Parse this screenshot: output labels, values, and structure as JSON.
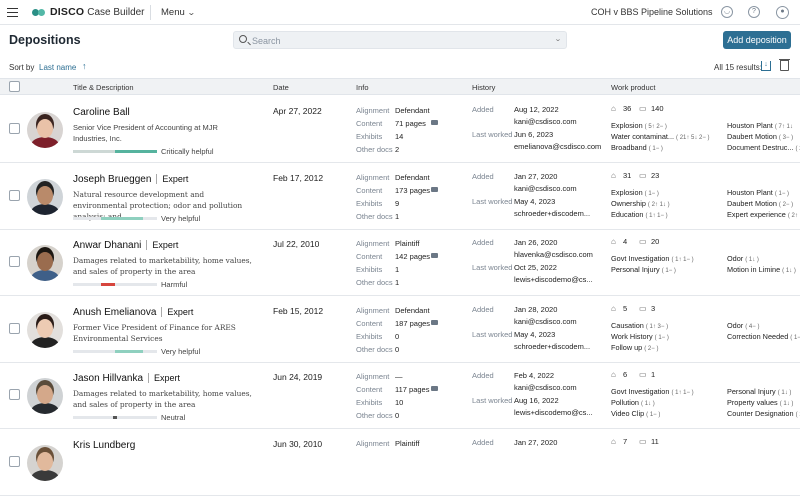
{
  "app": {
    "brand": "DISCO",
    "product": "Case Builder",
    "menu_label": "Menu",
    "project": "COH v BBS Pipeline Solutions"
  },
  "page": {
    "title": "Depositions",
    "search_placeholder": "Search",
    "add_button": "Add deposition"
  },
  "sortbar": {
    "sort_label": "Sort by",
    "sort_value": "Last name",
    "results": "All 15 results:"
  },
  "columns": {
    "title": "Title & Description",
    "date": "Date",
    "info": "Info",
    "history": "History",
    "work": "Work product"
  },
  "colors": {
    "accent": "#2d6f93",
    "helpful": "#56b39e",
    "harmful": "#d6453d",
    "up": "#2a9d6e"
  },
  "rows": [
    {
      "name": "Caroline Ball",
      "expert": "",
      "desc": "Senior Vice President of Accounting at MJR Industries, Inc.",
      "rating": "Critically helpful",
      "date": "Apr 27, 2022",
      "alignment": "Defendant",
      "content": "71 pages",
      "exhibits": "14",
      "other_docs": "2",
      "added_date": "Aug 12, 2022",
      "added_by": "kani@csdisco.com",
      "last_date": "Jun 6, 2023",
      "last_by": "emelianova@csdisco.com",
      "tags": "36",
      "comments": "140",
      "wp_left": [
        {
          "label": "Explosion",
          "pill": "( 5↑ 2− )"
        },
        {
          "label": "Water contaminat...",
          "pill": "( 21↑ 5↓ 2− )"
        },
        {
          "label": "Broadband",
          "pill": "( 1− )"
        }
      ],
      "wp_right": [
        {
          "label": "Houston Plant",
          "pill": "( 7↑ 1↓"
        },
        {
          "label": "Daubert Motion",
          "pill": "( 3− )"
        },
        {
          "label": "Document Destruc...",
          "pill": "( 2− )"
        }
      ]
    },
    {
      "name": "Joseph Brueggen",
      "expert": "Expert",
      "desc": "Natural resource development and environmental protection; odor and pollution analysis; and...",
      "rating": "Very helpful",
      "date": "Feb 17, 2012",
      "alignment": "Defendant",
      "content": "173 pages",
      "exhibits": "9",
      "other_docs": "1",
      "added_date": "Jan 27, 2020",
      "added_by": "kani@csdisco.com",
      "last_date": "May 4, 2023",
      "last_by": "schroeder+discodem...",
      "tags": "31",
      "comments": "23",
      "wp_left": [
        {
          "label": "Explosion",
          "pill": "( 1− )"
        },
        {
          "label": "Ownership",
          "pill": "( 2↑ 1↓ )"
        },
        {
          "label": "Education",
          "pill": "( 1↑ 1− )"
        }
      ],
      "wp_right": [
        {
          "label": "Houston Plant",
          "pill": "( 1− )"
        },
        {
          "label": "Daubert Motion",
          "pill": "( 2− )"
        },
        {
          "label": "Expert experience",
          "pill": "( 2↑"
        }
      ]
    },
    {
      "name": "Anwar Dhanani",
      "expert": "Expert",
      "desc": "Damages related to marketability, home values, and sales of property in the area",
      "rating": "Harmful",
      "date": "Jul 22, 2010",
      "alignment": "Plaintiff",
      "content": "142 pages",
      "exhibits": "1",
      "other_docs": "1",
      "added_date": "Jan 26, 2020",
      "added_by": "hlavenka@csdisco.com",
      "last_date": "Oct 25, 2022",
      "last_by": "lewis+discodemo@cs...",
      "tags": "4",
      "comments": "20",
      "wp_left": [
        {
          "label": "Govt Investigation",
          "pill": "( 1↑ 1− )"
        },
        {
          "label": "Personal Injury",
          "pill": "( 1− )"
        }
      ],
      "wp_right": [
        {
          "label": "Odor",
          "pill": "( 1↓ )"
        },
        {
          "label": "Motion in Limine",
          "pill": "( 1↓ )"
        }
      ]
    },
    {
      "name": "Anush Emelianova",
      "expert": "Expert",
      "desc": "Former Vice President of Finance for ARES Environmental Services",
      "rating": "Very helpful",
      "date": "Feb 15, 2012",
      "alignment": "Defendant",
      "content": "187 pages",
      "exhibits": "0",
      "other_docs": "0",
      "added_date": "Jan 28, 2020",
      "added_by": "kani@csdisco.com",
      "last_date": "May 4, 2023",
      "last_by": "schroeder+discodem...",
      "tags": "5",
      "comments": "3",
      "wp_left": [
        {
          "label": "Causation",
          "pill": "( 1↑ 3− )"
        },
        {
          "label": "Work History",
          "pill": "( 1− )"
        },
        {
          "label": "Follow up",
          "pill": "( 2− )"
        }
      ],
      "wp_right": [
        {
          "label": "Odor",
          "pill": "( 4− )"
        },
        {
          "label": "Correction Needed",
          "pill": "( 1− )"
        }
      ]
    },
    {
      "name": "Jason Hillvanka",
      "expert": "Expert",
      "desc": "Damages related to marketability, home values, and sales of property in the area",
      "rating": "Neutral",
      "date": "Jun 24, 2019",
      "alignment": "—",
      "content": "117 pages",
      "exhibits": "10",
      "other_docs": "0",
      "added_date": "Feb 4, 2022",
      "added_by": "kani@csdisco.com",
      "last_date": "Aug 16, 2022",
      "last_by": "lewis+discodemo@cs...",
      "tags": "6",
      "comments": "1",
      "wp_left": [
        {
          "label": "Govt Investigation",
          "pill": "( 1↑ 1− )"
        },
        {
          "label": "Pollution",
          "pill": "( 1↓ )"
        },
        {
          "label": "Video Clip",
          "pill": "( 1− )"
        }
      ],
      "wp_right": [
        {
          "label": "Personal Injury",
          "pill": "( 1↓ )"
        },
        {
          "label": "Property values",
          "pill": "( 1↓ )"
        },
        {
          "label": "Counter Designation",
          "pill": "( 1↓ )"
        }
      ]
    },
    {
      "name": "Kris Lundberg",
      "expert": "",
      "desc": "",
      "rating": "",
      "date": "Jun 30, 2010",
      "alignment": "Plaintiff",
      "content": "",
      "exhibits": "",
      "other_docs": "",
      "added_date": "Jan 27, 2020",
      "added_by": "",
      "last_date": "",
      "last_by": "",
      "tags": "7",
      "comments": "11",
      "wp_left": [],
      "wp_right": []
    }
  ],
  "labels": {
    "alignment": "Alignment",
    "content": "Content",
    "exhibits": "Exhibits",
    "other_docs": "Other docs",
    "added": "Added",
    "last_worked": "Last worked"
  }
}
